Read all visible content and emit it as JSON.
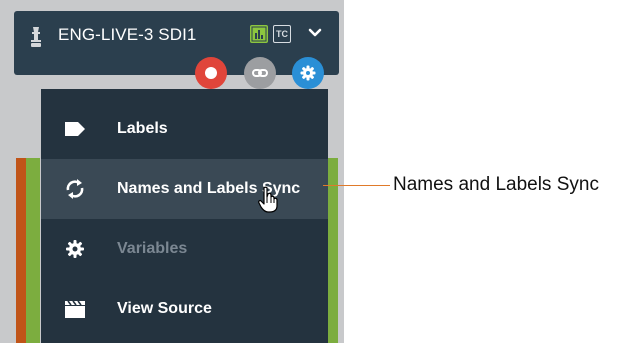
{
  "header": {
    "title": "ENG-LIVE-3 SDI1",
    "badge": "TC",
    "source_icon": "tally-light-icon",
    "meter_icon": "audio-meter-icon",
    "dropdown_icon": "chevron-down-icon"
  },
  "actions": [
    {
      "name": "record",
      "icon": "record-icon",
      "color": "#e0453a"
    },
    {
      "name": "link",
      "icon": "link-icon",
      "color": "#9c9ea1"
    },
    {
      "name": "settings",
      "icon": "gear-icon",
      "color": "#2a8fd6"
    }
  ],
  "menu": {
    "items": [
      {
        "label": "Labels",
        "icon": "tag-icon",
        "state": "normal"
      },
      {
        "label": "Names and Labels Sync",
        "icon": "sync-icon",
        "state": "hover"
      },
      {
        "label": "Variables",
        "icon": "gear-icon",
        "state": "disabled"
      },
      {
        "label": "View Source",
        "icon": "clapperboard-icon",
        "state": "normal"
      }
    ]
  },
  "callout": {
    "text": "Names and Labels Sync"
  },
  "colors": {
    "header_bg": "#2b3f4e",
    "menu_bg": "#24333f",
    "menu_hover_bg": "#3a4955",
    "accent_green": "#7cad3f",
    "accent_orange": "#c05418"
  }
}
